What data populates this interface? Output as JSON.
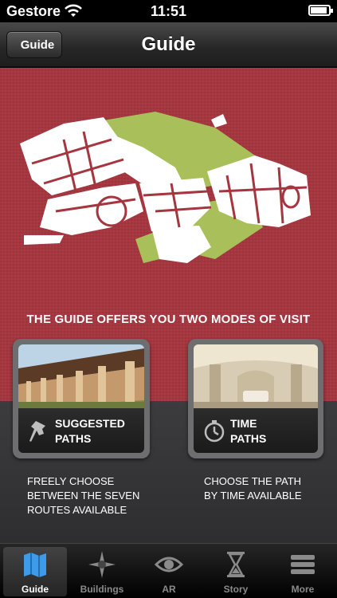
{
  "status": {
    "carrier": "Gestore",
    "time": "11:51",
    "battery_fraction": 0.9
  },
  "nav": {
    "back_label": "Guide",
    "title": "Guide"
  },
  "main": {
    "headline": "THE GUIDE OFFERS YOU TWO MODES OF VISIT",
    "modes": [
      {
        "label_line1": "SUGGESTED",
        "label_line2": "PATHS",
        "icon": "pin-icon",
        "desc_line1": "FREELY CHOOSE",
        "desc_line2": "BETWEEN THE SEVEN",
        "desc_line3": "ROUTES AVAILABLE"
      },
      {
        "label_line1": "TIME",
        "label_line2": "PATHS",
        "icon": "clock-icon",
        "desc_line1": "CHOOSE THE PATH",
        "desc_line2": "BY TIME AVAILABLE",
        "desc_line3": ""
      }
    ]
  },
  "tabs": [
    {
      "label": "Guide",
      "icon": "map-icon",
      "active": true
    },
    {
      "label": "Buildings",
      "icon": "compass-icon",
      "active": false
    },
    {
      "label": "AR",
      "icon": "eye-icon",
      "active": false
    },
    {
      "label": "Story",
      "icon": "hourglass-icon",
      "active": false
    },
    {
      "label": "More",
      "icon": "more-icon",
      "active": false
    }
  ],
  "colors": {
    "accent_red": "#a5353e",
    "map_green": "#a9c05a",
    "panel_gray": "#353537"
  }
}
